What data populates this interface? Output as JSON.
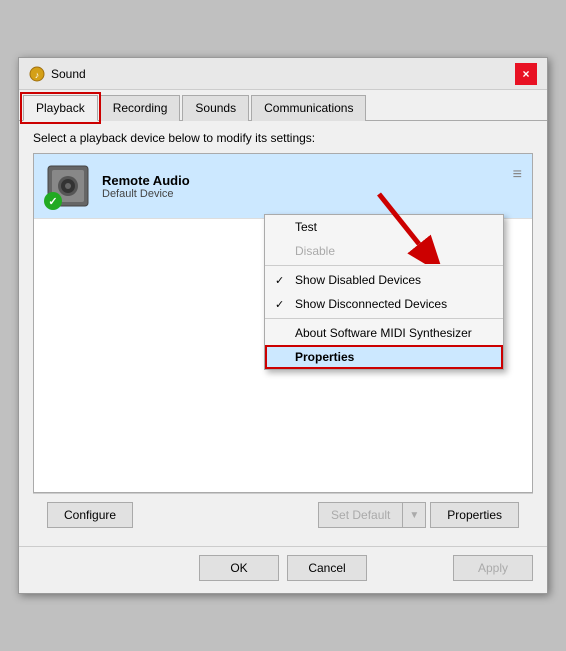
{
  "title": {
    "text": "Sound",
    "close_label": "×"
  },
  "tabs": [
    {
      "label": "Playback",
      "active": true
    },
    {
      "label": "Recording",
      "active": false
    },
    {
      "label": "Sounds",
      "active": false
    },
    {
      "label": "Communications",
      "active": false
    }
  ],
  "description": "Select a playback device below to modify its settings:",
  "device": {
    "name": "Remote Audio",
    "status": "Default Device"
  },
  "context_menu": {
    "items": [
      {
        "label": "Test",
        "disabled": false,
        "checked": false
      },
      {
        "label": "Disable",
        "disabled": true,
        "checked": false
      },
      {
        "separator_before": true
      },
      {
        "label": "Show Disabled Devices",
        "disabled": false,
        "checked": true
      },
      {
        "label": "Show Disconnected Devices",
        "disabled": false,
        "checked": true
      },
      {
        "separator_after": true
      },
      {
        "label": "About Software MIDI Synthesizer",
        "disabled": false,
        "checked": false
      },
      {
        "label": "Properties",
        "disabled": false,
        "checked": false,
        "highlighted": true
      }
    ]
  },
  "buttons": {
    "configure": "Configure",
    "set_default": "Set Default",
    "properties": "Properties",
    "ok": "OK",
    "cancel": "Cancel",
    "apply": "Apply"
  }
}
